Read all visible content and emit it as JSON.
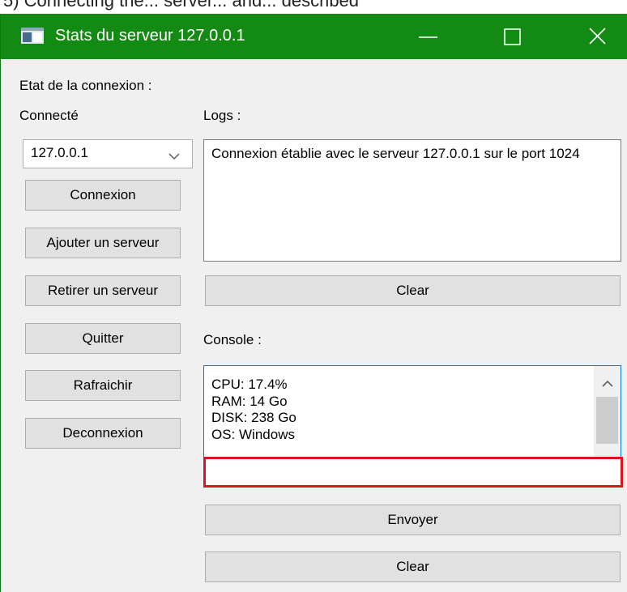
{
  "page_top_text": "5) Connecting the... server... and... described",
  "window": {
    "title": "Stats du serveur 127.0.0.1",
    "titlebar_color": "#138a13"
  },
  "left": {
    "connection_state_label": "Etat de la connexion :",
    "connection_status": "Connecté",
    "server_select": {
      "selected": "127.0.0.1"
    },
    "buttons": {
      "connect": "Connexion",
      "add_server": "Ajouter un serveur",
      "remove_server": "Retirer un serveur",
      "quit": "Quitter",
      "refresh": "Rafraichir",
      "disconnect": "Deconnexion"
    }
  },
  "logs": {
    "label": "Logs :",
    "content": "Connexion établie avec le serveur 127.0.0.1 sur le port 1024",
    "clear_label": "Clear"
  },
  "console": {
    "label": "Console :",
    "lines": [
      "CPU: 17.4%",
      "RAM: 14 Go",
      "DISK: 238 Go",
      "OS: Windows"
    ],
    "input": {
      "value": "",
      "placeholder": ""
    },
    "send_label": "Envoyer",
    "clear_label": "Clear",
    "highlight_color": "#e0141e"
  }
}
